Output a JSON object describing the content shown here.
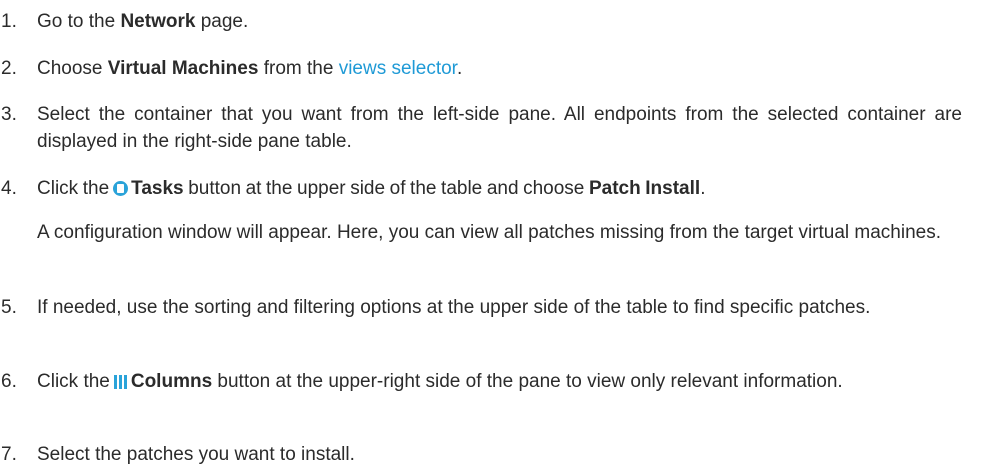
{
  "steps": [
    {
      "number": "1.",
      "pre": "Go to the ",
      "bold": "Network",
      "post": " page."
    },
    {
      "number": "2.",
      "pre": "Choose ",
      "bold": "Virtual Machines",
      "mid": " from the ",
      "link": "views selector",
      "post": "."
    },
    {
      "number": "3.",
      "text": "Select the container that you want from the left-side pane. All endpoints from the selected container are displayed in the right-side pane table."
    },
    {
      "number": "4.",
      "pre": "Click the",
      "icon": "tasks-icon",
      "bold": "Tasks",
      "mid": " button at the upper side of the table and choose ",
      "bold2": "Patch Install",
      "post": ".",
      "note": "A configuration window will appear. Here, you can view all patches missing from the target virtual machines."
    },
    {
      "number": "5.",
      "text": "If needed, use the sorting and filtering options at the upper side of the table to find specific patches."
    },
    {
      "number": "6.",
      "pre": "Click the",
      "icon": "columns-icon",
      "bold": "Columns",
      "post": " button at the upper-right side of the pane to view only relevant information."
    },
    {
      "number": "7.",
      "text": "Select the patches you want to install."
    }
  ],
  "colors": {
    "text": "#2b2b2b",
    "link": "#1f9ad6",
    "icon": "#2aa3d9"
  }
}
